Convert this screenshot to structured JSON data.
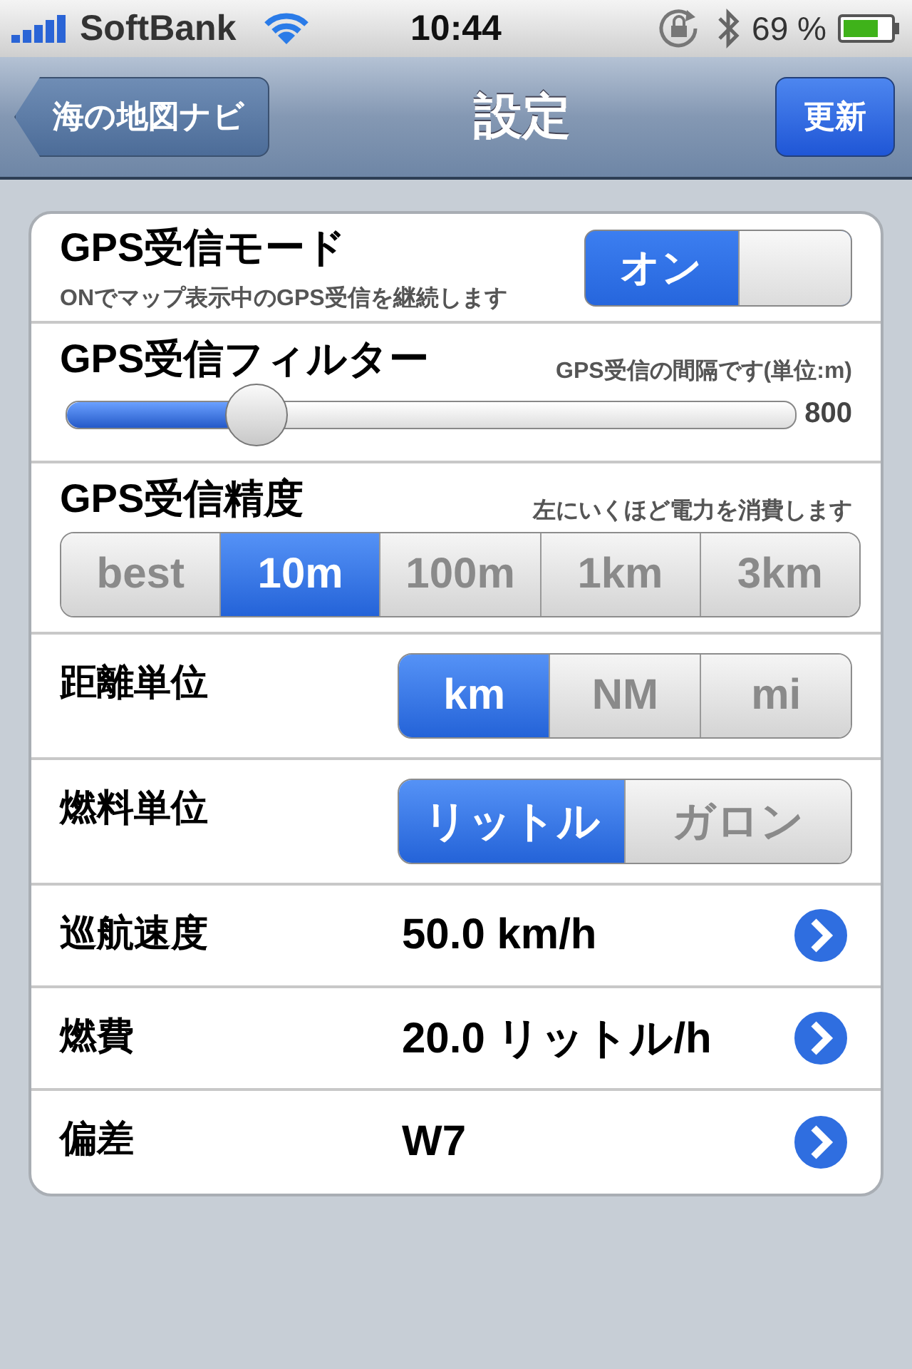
{
  "status_bar": {
    "carrier": "SoftBank",
    "time": "10:44",
    "battery": "69 %"
  },
  "nav_bar": {
    "back_button": "海の地図ナビ",
    "title": "設定",
    "right_button": "更新"
  },
  "settings": [
    {
      "kind": "toggle",
      "label": "GPS受信モード",
      "description": "ONでマップ表示中のGPS受信を継続します",
      "on": true,
      "on_label": "オン"
    },
    {
      "kind": "slider",
      "label": "GPS受信フィルター",
      "description": "GPS受信の間隔です(単位:m)",
      "level": 0.26,
      "reading": "800"
    },
    {
      "kind": "segmented",
      "label": "GPS受信精度",
      "description": "左にいくほど電力を消費します",
      "options": [
        {
          "label": "best",
          "selected": false
        },
        {
          "label": "10m",
          "selected": true
        },
        {
          "label": "100m",
          "selected": false
        },
        {
          "label": "1km",
          "selected": false
        },
        {
          "label": "3km",
          "selected": false
        }
      ]
    },
    {
      "kind": "segmented",
      "label": "距離単位",
      "options": [
        {
          "label": "km",
          "selected": true
        },
        {
          "label": "NM",
          "selected": false
        },
        {
          "label": "mi",
          "selected": false
        }
      ]
    },
    {
      "kind": "segmented",
      "label": "燃料単位",
      "options": [
        {
          "label": "リットル",
          "selected": true
        },
        {
          "label": "ガロン",
          "selected": false
        }
      ]
    },
    {
      "kind": "value",
      "label": "巡航速度",
      "value": "50.0 km/h"
    },
    {
      "kind": "value",
      "label": "燃費",
      "value": "20.0 リットル/h"
    },
    {
      "kind": "value",
      "label": "偏差",
      "value": "W7"
    }
  ]
}
